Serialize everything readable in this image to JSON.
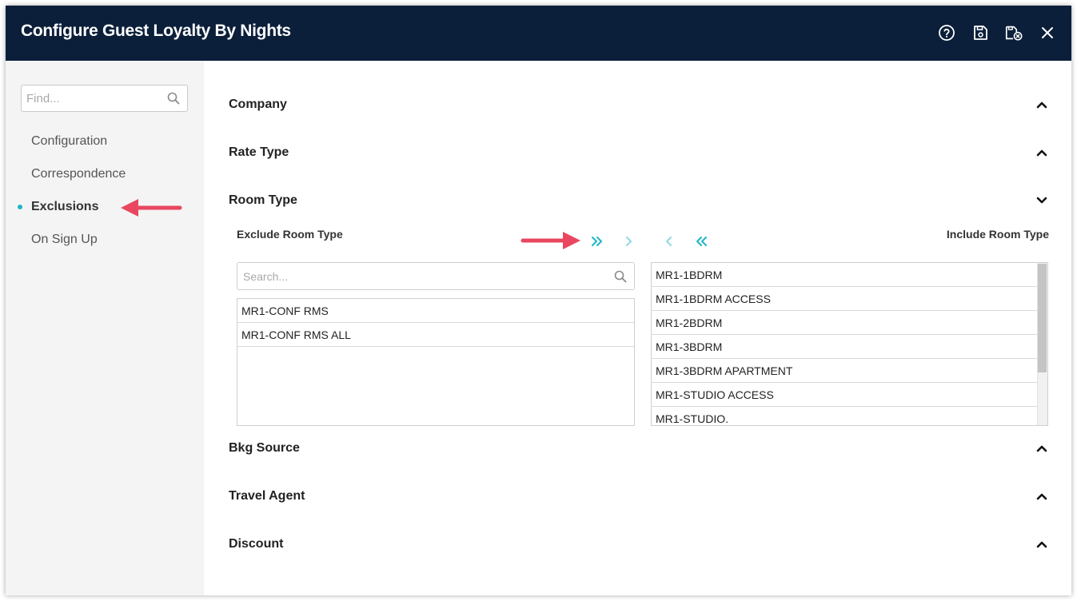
{
  "window": {
    "title": "Configure Guest Loyalty By Nights",
    "header_icons": [
      "help-icon",
      "save-icon",
      "save-close-icon",
      "close-icon"
    ]
  },
  "sidebar": {
    "find_placeholder": "Find...",
    "items": [
      {
        "label": "Configuration",
        "active": false
      },
      {
        "label": "Correspondence",
        "active": false
      },
      {
        "label": "Exclusions",
        "active": true
      },
      {
        "label": "On Sign Up",
        "active": false
      }
    ]
  },
  "sections": {
    "company": {
      "label": "Company",
      "expanded": false
    },
    "rate_type": {
      "label": "Rate Type",
      "expanded": false
    },
    "room_type": {
      "label": "Room Type",
      "expanded": true
    },
    "bkg_source": {
      "label": "Bkg Source",
      "expanded": false
    },
    "travel_agent": {
      "label": "Travel Agent",
      "expanded": false
    },
    "discount": {
      "label": "Discount",
      "expanded": false
    }
  },
  "room_type": {
    "exclude_label": "Exclude Room Type",
    "include_label": "Include Room Type",
    "search_placeholder": "Search...",
    "excluded": [
      "MR1-CONF RMS",
      "MR1-CONF RMS ALL"
    ],
    "included": [
      "MR1-1BDRM",
      "MR1-1BDRM ACCESS",
      "MR1-2BDRM",
      "MR1-3BDRM",
      "MR1-3BDRM APARTMENT",
      "MR1-STUDIO ACCESS",
      "MR1-STUDIO."
    ]
  },
  "colors": {
    "header_bg": "#0b1f3a",
    "accent": "#1fb5c6",
    "annotation_arrow": "#e8475f",
    "sidebar_bg": "#f4f4f4"
  }
}
